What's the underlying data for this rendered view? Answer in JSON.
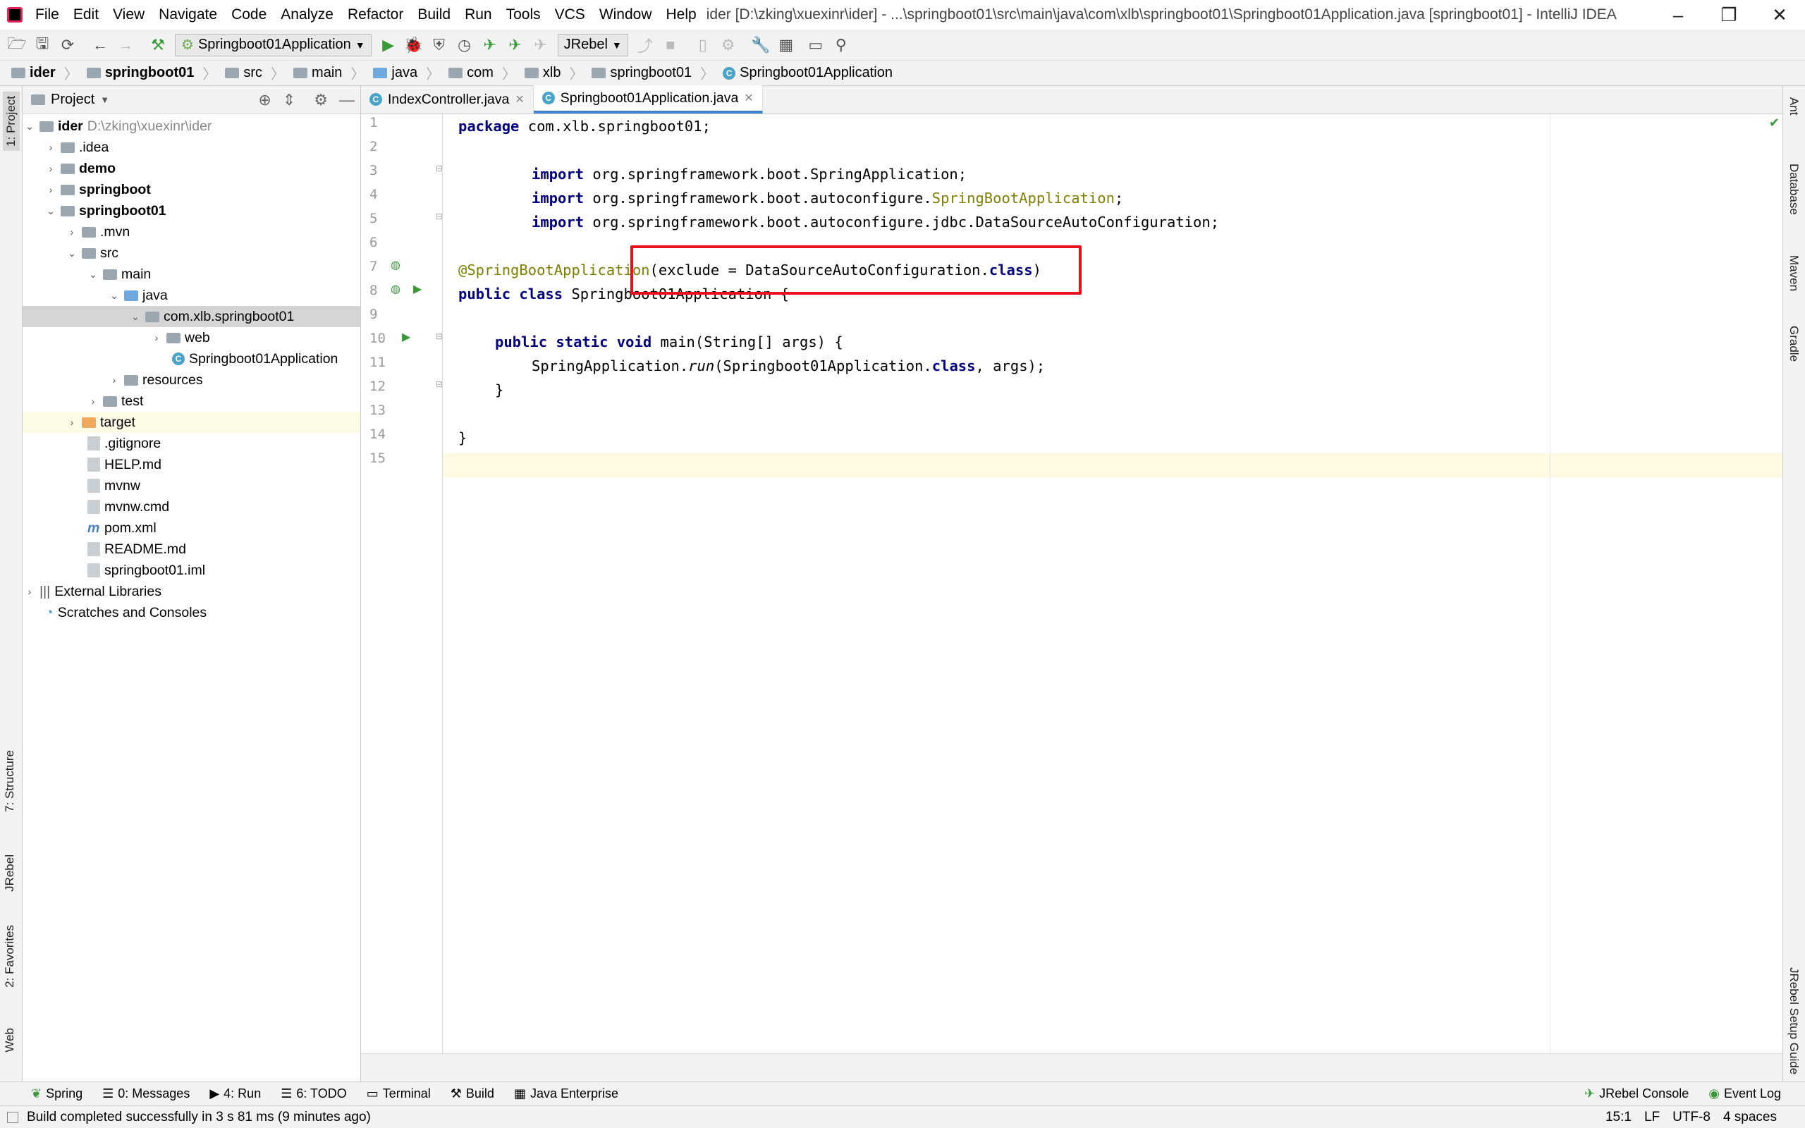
{
  "app": {
    "title": "ider [D:\\zking\\xuexinr\\ider] - ...\\springboot01\\src\\main\\java\\com\\xlb\\springboot01\\Springboot01Application.java [springboot01] - IntelliJ IDEA",
    "menu": [
      "File",
      "Edit",
      "View",
      "Navigate",
      "Code",
      "Analyze",
      "Refactor",
      "Build",
      "Run",
      "Tools",
      "VCS",
      "Window",
      "Help"
    ]
  },
  "toolbar": {
    "run_config": "Springboot01Application",
    "jrebel_combo": "JRebel"
  },
  "breadcrumbs": [
    "ider",
    "springboot01",
    "src",
    "main",
    "java",
    "com",
    "xlb",
    "springboot01",
    "Springboot01Application"
  ],
  "project_panel": {
    "title": "Project",
    "root_name": "ider",
    "root_path": "D:\\zking\\xuexinr\\ider",
    "nodes": [
      ".idea",
      "demo",
      "springboot",
      "springboot01",
      ".mvn",
      "src",
      "main",
      "java",
      "com.xlb.springboot01",
      "web",
      "Springboot01Application",
      "resources",
      "test",
      "target",
      ".gitignore",
      "HELP.md",
      "mvnw",
      "mvnw.cmd",
      "pom.xml",
      "README.md",
      "springboot01.iml",
      "External Libraries",
      "Scratches and Consoles"
    ]
  },
  "editor": {
    "tabs": [
      "IndexController.java",
      "Springboot01Application.java"
    ],
    "line_numbers": [
      "1",
      "2",
      "3",
      "4",
      "5",
      "6",
      "7",
      "8",
      "9",
      "10",
      "11",
      "12",
      "13",
      "14",
      "15"
    ],
    "code": {
      "l1_kw": "package",
      "l1_rest": " com.xlb.springboot01;",
      "l3_kw": "import",
      "l3_rest": " org.springframework.boot.SpringApplication;",
      "l4_kw": "import",
      "l4_rest": " org.springframework.boot.autoconfigure.",
      "l4_ann": "SpringBootApplication",
      "l4_end": ";",
      "l5_kw": "import",
      "l5_rest": " org.springframework.boot.autoconfigure.jdbc.DataSourceAutoConfiguration;",
      "l7_ann": "@SpringBootApplication",
      "l7_rest": "(exclude = DataSourceAutoConfiguration.",
      "l7_kw": "class",
      "l7_end": ")",
      "l8_kw": "public class",
      "l8_rest": " Springboot01Application {",
      "l10_kw": "public static void",
      "l10_rest": " main(String[] args) {",
      "l11_a": "SpringApplication.",
      "l11_it": "run",
      "l11_b": "(Springboot01Application.",
      "l11_kw": "class",
      "l11_c": ", args);",
      "l12": "}",
      "l14": "}"
    }
  },
  "left_strip": [
    "1: Project",
    "7: Structure",
    "JRebel",
    "2: Favorites",
    "Web"
  ],
  "right_strip": [
    "Ant",
    "Database",
    "Maven",
    "Gradle",
    "JRebel Setup Guide"
  ],
  "bottom_tabs": [
    "Spring",
    "0: Messages",
    "4: Run",
    "6: TODO",
    "Terminal",
    "Build",
    "Java Enterprise"
  ],
  "bottom_right_tabs": [
    "JRebel Console",
    "Event Log"
  ],
  "status": {
    "message": "Build completed successfully in 3 s 81 ms (9 minutes ago)",
    "position": "15:1",
    "line_sep": "LF",
    "encoding": "UTF-8",
    "indent": "4 spaces"
  },
  "colors": {
    "highlight_box": "#e8101c",
    "keyword": "#000080",
    "annotation": "#808000",
    "current_line": "#fffae3"
  }
}
